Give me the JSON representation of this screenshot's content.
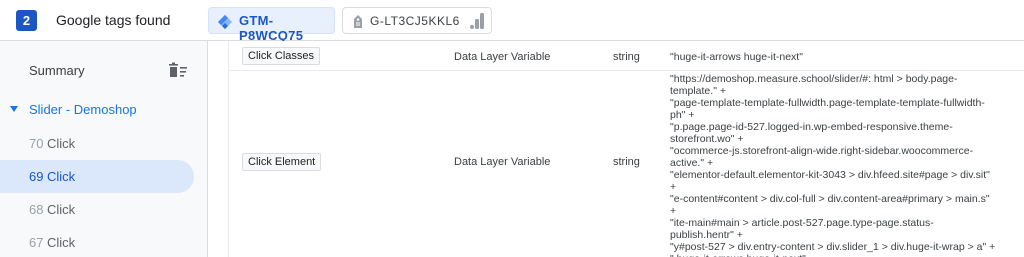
{
  "header": {
    "tags_count": "2",
    "tags_found_label": "Google tags found",
    "gtm_container": "GTM-P8WCQ75",
    "ga_property": "G-LT3CJ5KKL6"
  },
  "sidebar": {
    "summary_label": "Summary",
    "page_name": "Slider - Demoshop",
    "events": [
      {
        "num": "70",
        "name": "Click"
      },
      {
        "num": "69",
        "name": "Click"
      },
      {
        "num": "68",
        "name": "Click"
      },
      {
        "num": "67",
        "name": "Click"
      }
    ],
    "selected_event_index": 1
  },
  "variables": [
    {
      "name": "Click Classes",
      "type": "Data Layer Variable",
      "data_type": "string",
      "value": "\"huge-it-arrows huge-it-next\""
    },
    {
      "name": "Click Element",
      "type": "Data Layer Variable",
      "data_type": "string",
      "value": "\"https://demoshop.measure.school/slider/#: html > body.page-\ntemplate.\" +\n\"page-template-template-fullwidth.page-template-template-fullwidth-\nph\" +\n\"p.page.page-id-527.logged-in.wp-embed-responsive.theme-\nstorefront.wo\" +\n\"ocommerce-js.storefront-align-wide.right-sidebar.woocommerce-\nactive.\" +\n\"elementor-default.elementor-kit-3043 > div.hfeed.site#page > div.sit\"\n+\n\"e-content#content > div.col-full > div.content-area#primary > main.s\"\n+\n\"ite-main#main > article.post-527.page.type-page.status-\npublish.hentr\" +\n\"y#post-527 > div.entry-content > div.slider_1 > div.huge-it-wrap > a\" +\n\".huge-it-arrows.huge-it-next\""
    }
  ],
  "colors": {
    "accent": "#1a57c4",
    "selected_bg": "#dbe7fb",
    "sidebar_bg": "#f8f9fa"
  }
}
